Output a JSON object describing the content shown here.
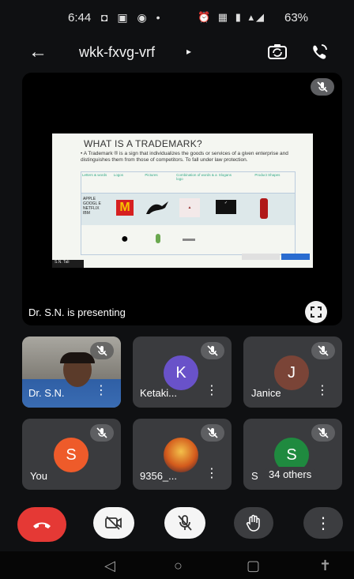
{
  "status_bar": {
    "time": "6:44",
    "battery": "63%"
  },
  "app_bar": {
    "meeting_code": "wkk-fxvg-vrf",
    "back_icon": "arrow-left-icon",
    "caret": "▸"
  },
  "presentation": {
    "label": "Dr. S.N. is presenting",
    "slide": {
      "title": "WHAT IS A TRADEMARK?",
      "bullet": "• A Trademark ® is a sign that individualizes the goods or services of a given enterprise and distinguishes them from those of competitors. To fall under law protection.",
      "columns": [
        "Letters & words",
        "Logos",
        "Pictures",
        "Combination of words & a logo",
        "Slogans",
        "Product Shapes"
      ],
      "row_text": "APPLE GOOGL E NETFLIX IBM",
      "footer": "S.N. Tali"
    }
  },
  "participants": [
    {
      "name": "Dr. S.N.",
      "type": "video",
      "muted": true
    },
    {
      "name": "Ketaki...",
      "initial": "K",
      "color": "#6952c9",
      "muted": true
    },
    {
      "name": "Janice",
      "initial": "J",
      "color": "#7a4437",
      "muted": true
    },
    {
      "name": "You",
      "initial": "S",
      "color": "#ee5b2a",
      "muted": true
    },
    {
      "name": "9356_...",
      "type": "image-avatar",
      "muted": true
    },
    {
      "name": "S",
      "initial": "S",
      "color": "#1f8a3f",
      "muted": true,
      "others": "34 others"
    }
  ],
  "controls": {
    "end_call": "end-call",
    "camera": "camera-off",
    "mic": "mic-off",
    "raise_hand": "raise-hand",
    "more": "more-options"
  },
  "colors": {
    "end_call_red": "#e53935",
    "tile_bg": "#3a3b3e",
    "ctrl_dark": "#3c3d40",
    "ctrl_light": "#f5f5f5"
  }
}
